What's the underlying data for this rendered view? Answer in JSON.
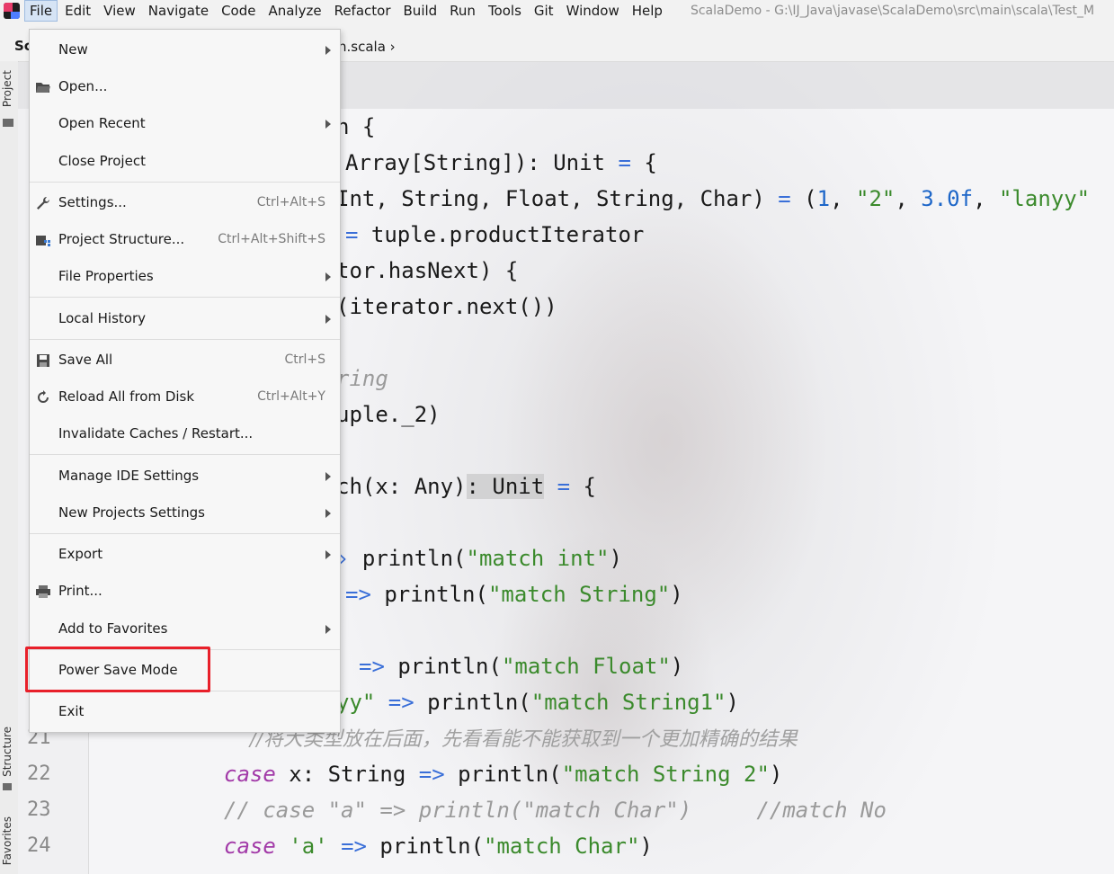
{
  "menubar": {
    "items": [
      "File",
      "Edit",
      "View",
      "Navigate",
      "Code",
      "Analyze",
      "Refactor",
      "Build",
      "Run",
      "Tools",
      "Git",
      "Window",
      "Help"
    ],
    "window_title": "ScalaDemo - G:\\IJ_Java\\javase\\ScalaDemo\\src\\main\\scala\\Test_M"
  },
  "navbar": {
    "project_initial": "Sc",
    "breadcrumb": "h.scala"
  },
  "toolstrip": {
    "project": "Project",
    "structure": "Structure",
    "favorites": "Favorites"
  },
  "file_menu": {
    "items": [
      {
        "label": "New",
        "shortcut": "",
        "submenu": true
      },
      {
        "label": "Open...",
        "shortcut": "",
        "submenu": false,
        "icon": "folder-open-icon"
      },
      {
        "label": "Open Recent",
        "shortcut": "",
        "submenu": true
      },
      {
        "label": "Close Project",
        "shortcut": "",
        "submenu": false
      },
      {
        "label": "Settings...",
        "shortcut": "Ctrl+Alt+S",
        "submenu": false,
        "icon": "wrench-icon"
      },
      {
        "label": "Project Structure...",
        "shortcut": "Ctrl+Alt+Shift+S",
        "submenu": false,
        "icon": "project-structure-icon"
      },
      {
        "label": "File Properties",
        "shortcut": "",
        "submenu": true
      },
      {
        "label": "Local History",
        "shortcut": "",
        "submenu": true
      },
      {
        "label": "Save All",
        "shortcut": "Ctrl+S",
        "submenu": false,
        "icon": "save-icon"
      },
      {
        "label": "Reload All from Disk",
        "shortcut": "Ctrl+Alt+Y",
        "submenu": false,
        "icon": "reload-icon"
      },
      {
        "label": "Invalidate Caches / Restart...",
        "shortcut": "",
        "submenu": false
      },
      {
        "label": "Manage IDE Settings",
        "shortcut": "",
        "submenu": true
      },
      {
        "label": "New Projects Settings",
        "shortcut": "",
        "submenu": true
      },
      {
        "label": "Export",
        "shortcut": "",
        "submenu": true
      },
      {
        "label": "Print...",
        "shortcut": "",
        "submenu": false,
        "icon": "printer-icon"
      },
      {
        "label": "Add to Favorites",
        "shortcut": "",
        "submenu": true
      },
      {
        "label": "Power Save Mode",
        "shortcut": "",
        "submenu": false
      },
      {
        "label": "Exit",
        "shortcut": "",
        "submenu": false
      }
    ]
  },
  "editor": {
    "line_numbers": [
      "21",
      "22",
      "23",
      "24"
    ],
    "code": {
      "l1": "n {",
      "l2a": "Array[String]): Unit ",
      "l2b": "=",
      "l2c": " {",
      "l3a": "Int, String, Float, String, Char) ",
      "l3b": "=",
      "l3c": " (",
      "l3d": "1",
      "l3e": ", ",
      "l3f": "\"2\"",
      "l3g": ", ",
      "l3h": "3.0f",
      "l3i": ", ",
      "l3j": "\"lanyy\"",
      "l4a": "=",
      "l4b": " tuple.productIterator",
      "l5": "tor.hasNext) {",
      "l6": "(iterator.next())",
      "l7": "ring",
      "l8": "uple._2)",
      "l9a": "ch(x: Any)",
      "l9b": ": Unit",
      "l9c": " ",
      "l9d": "=",
      "l9e": " {",
      "l10a": "›",
      "l10b": " println(",
      "l10c": "\"match int\"",
      "l10d": ")",
      "l11a": "=>",
      "l11b": " println(",
      "l11c": "\"match String\"",
      "l11d": ")",
      "l12a": "=>",
      "l12b": " println(",
      "l12c": "\"match Float\"",
      "l12d": ")",
      "l13a": "yy\"",
      "l13b": " => ",
      "l13c": "println(",
      "l13d": "\"match String1\"",
      "l13e": ")",
      "l14": "//将大类型放在后面，先看看能不能获取到一个更加精确的结果",
      "l15a": "case",
      "l15b": " x: String ",
      "l15c": "=>",
      "l15d": " println(",
      "l15e": "\"match String 2\"",
      "l15f": ")",
      "l16": "// case \"a\" => println(\"match Char\")     //match No",
      "l17a": "case",
      "l17b": " ",
      "l17c": "'a'",
      "l17d": " ",
      "l17e": "=>",
      "l17f": " println(",
      "l17g": "\"match Char\"",
      "l17h": ")"
    }
  },
  "colors": {
    "annotation_box": "#e8202a",
    "keyword": "#a23aa8",
    "string": "#3b8a2c",
    "operator": "#3a6fd8"
  }
}
